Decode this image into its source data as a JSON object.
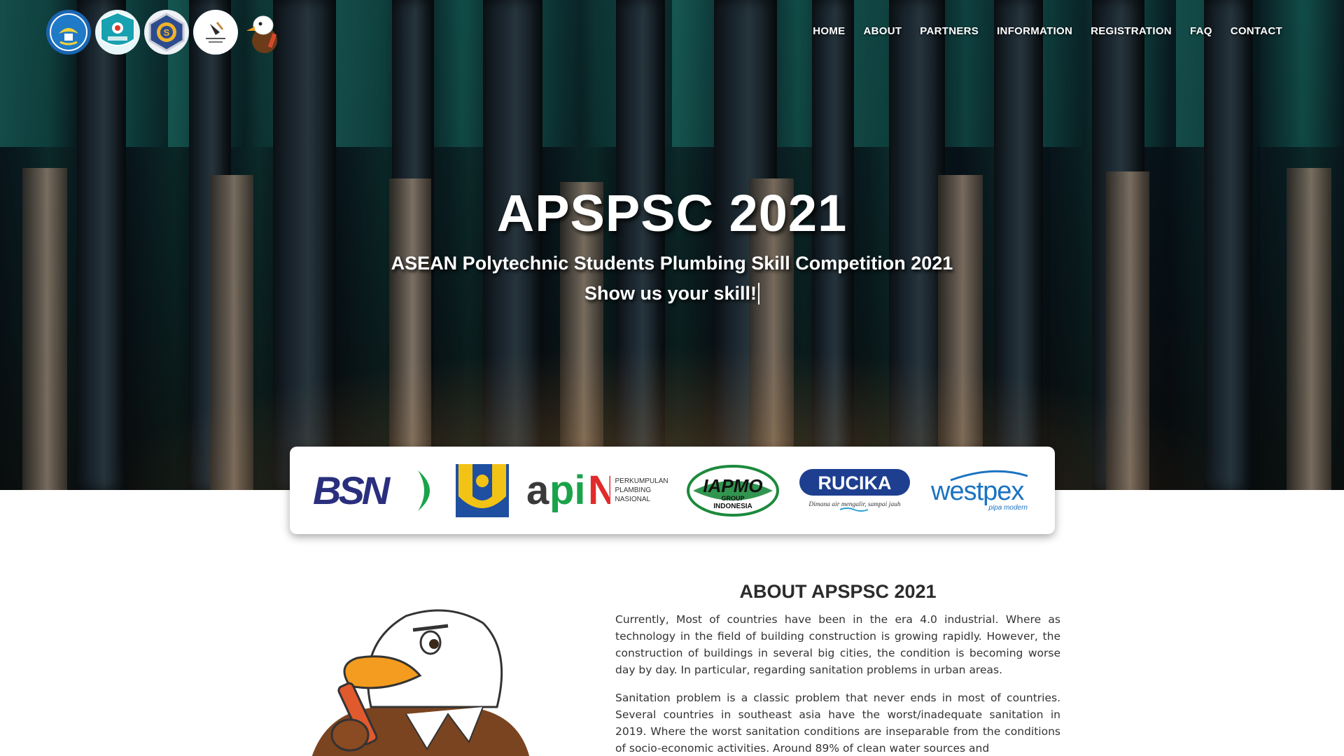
{
  "nav": {
    "items": [
      "HOME",
      "ABOUT",
      "PARTNERS",
      "INFORMATION",
      "REGISTRATION",
      "FAQ",
      "CONTACT"
    ]
  },
  "header_logos": [
    "tut-wuri-handayani-logo",
    "politeknik-negeri-jakarta-logo",
    "institution-seal-logo",
    "apspsc-2021-logo",
    "eagle-mascot-logo"
  ],
  "hero": {
    "title": "APSPSC 2021",
    "subtitle": "ASEAN Polytechnic Students Plumbing Skill Competition 2021",
    "tagline": "Show us your skill!"
  },
  "partners": {
    "bsn": "BSN",
    "apin_main": "apin",
    "apin_sub": [
      "PERKUMPULAN",
      "PLAMBING",
      "NASIONAL"
    ],
    "iapmo_main": "IAPMO",
    "iapmo_sub1": "GROUP",
    "iapmo_sub2": "INDONESIA",
    "rucika_main": "RUCIKA",
    "rucika_tag": "Dimana air mengalir, sampai jauh",
    "westpex_main": "westpex",
    "westpex_tag": "pipa modern"
  },
  "about": {
    "heading": "ABOUT APSPSC 2021",
    "p1": "Currently, Most of countries have been in the era 4.0 industrial. Where as technology in the field of building construction is growing rapidly. However, the construction of buildings in several big cities, the condition is becoming worse day by day. In particular, regarding sanitation problems in urban areas.",
    "p2": "Sanitation problem is a classic problem that never ends in most of countries. Several countries in southeast asia have the worst/inadequate sanitation in 2019. Where the worst sanitation conditions are inseparable from the conditions of socio-economic activities. Around 89% of clean water sources and"
  },
  "colors": {
    "bsn_blue": "#2a2f7d",
    "bsn_green": "#1aa34a",
    "pu_yellow": "#f2c314",
    "pu_blue": "#1f4fa0",
    "apin_green": "#1aa34a",
    "apin_red": "#e12b2b",
    "iapmo_green": "#1c8a3c",
    "rucika_blue": "#1e3f8f",
    "westpex_blue": "#1b73c0"
  }
}
